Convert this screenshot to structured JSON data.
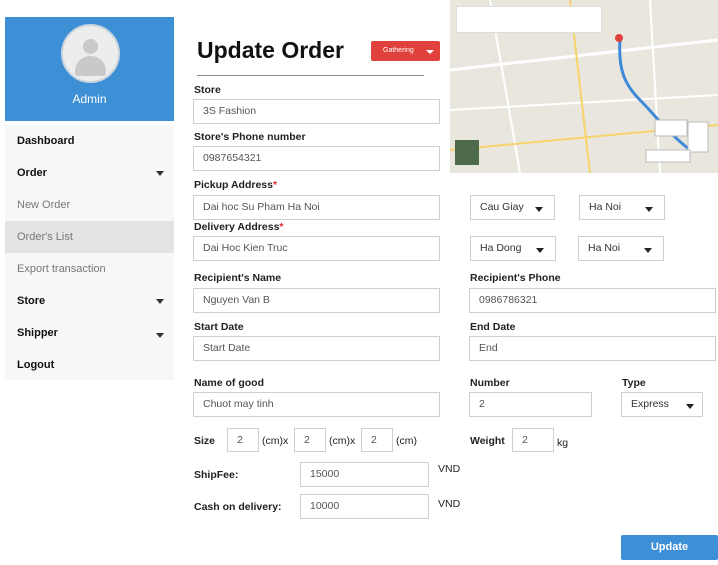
{
  "sidebar": {
    "user_name": "Admin",
    "menu": [
      {
        "label": "Dashboard"
      },
      {
        "label": "Order"
      },
      {
        "label": "New Order"
      },
      {
        "label": "Order's List"
      },
      {
        "label": "Export transaction"
      },
      {
        "label": "Store"
      },
      {
        "label": "Shipper"
      },
      {
        "label": "Logout"
      }
    ]
  },
  "header": {
    "title": "Update Order",
    "status_label": "Gathering"
  },
  "form": {
    "store_label": "Store",
    "store_value": "3S Fashion",
    "store_phone_label": "Store's Phone number",
    "store_phone_value": "0987654321",
    "pickup_label": "Pickup Address",
    "pickup_value": "Dai hoc Su Pham Ha Noi",
    "pickup_district": "Cau Giay",
    "pickup_city": "Ha Noi",
    "delivery_label": "Delivery Address",
    "delivery_value": "Dai Hoc Kien Truc",
    "delivery_district": "Ha Dong",
    "delivery_city": "Ha Noi",
    "recipient_name_label": "Recipient's Name",
    "recipient_name_value": "Nguyen Van B",
    "recipient_phone_label": "Recipient's Phone",
    "recipient_phone_value": "0986786321",
    "start_date_label": "Start Date",
    "start_date_placeholder": "Start Date",
    "end_date_label": "End Date",
    "end_date_placeholder": "End",
    "good_name_label": "Name of good",
    "good_name_value": "Chuot may tinh",
    "number_label": "Number",
    "number_value": "2",
    "type_label": "Type",
    "type_value": "Express",
    "size_label": "Size",
    "size_w": "2",
    "size_h": "2",
    "size_d": "2",
    "unit_cm_x": "(cm)x",
    "unit_cm": "(cm)",
    "weight_label": "Weight",
    "weight_value": "2",
    "weight_unit": "kg",
    "shipfee_label": "ShipFee:",
    "shipfee_value": "15000",
    "currency": "VND",
    "cod_label": "Cash on delivery:",
    "cod_value": "10000",
    "update_label": "Update"
  },
  "colors": {
    "accent": "#3d8fd6",
    "status": "#e0413c"
  }
}
